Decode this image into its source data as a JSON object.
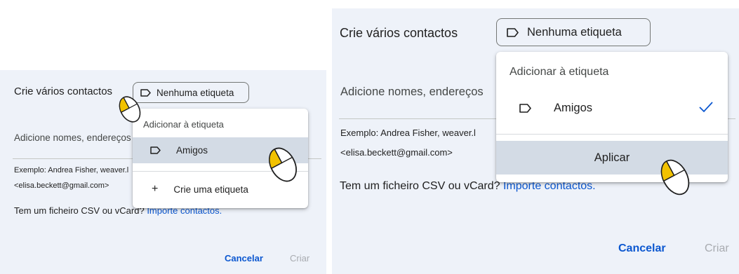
{
  "left": {
    "title": "Crie vários contactos",
    "label_chip": "Nenhuma etiqueta",
    "instructions": "Adicione nomes, endereços",
    "example_line1": "Exemplo: Andrea Fisher, weaver.l",
    "example_line2": "<elisa.beckett@gmail.com>",
    "csv_text": "Tem um ficheiro CSV ou vCard?",
    "import_link": "Importe contactos.",
    "cancel": "Cancelar",
    "create": "Criar",
    "menu": {
      "header": "Adicionar à etiqueta",
      "items": [
        {
          "label": "Amigos",
          "icon": "label-icon"
        },
        {
          "label": "Crie uma etiqueta",
          "icon": "plus-icon"
        }
      ]
    }
  },
  "right": {
    "title": "Crie vários contactos",
    "label_chip": "Nenhuma etiqueta",
    "instructions": "Adicione nomes, endereços",
    "example_line1": "Exemplo: Andrea Fisher, weaver.l",
    "example_line2": "<elisa.beckett@gmail.com>",
    "csv_text": "Tem um ficheiro CSV ou vCard?",
    "import_link": "Importe contactos.",
    "cancel": "Cancelar",
    "create": "Criar",
    "menu": {
      "header": "Adicionar à etiqueta",
      "items": [
        {
          "label": "Amigos",
          "icon": "label-icon",
          "checked": true
        }
      ],
      "apply": "Aplicar"
    }
  },
  "colors": {
    "panel_bg": "#eef2f9",
    "link": "#0b57d0",
    "highlight": "#d3dbe5",
    "check": "#0b57d0"
  }
}
